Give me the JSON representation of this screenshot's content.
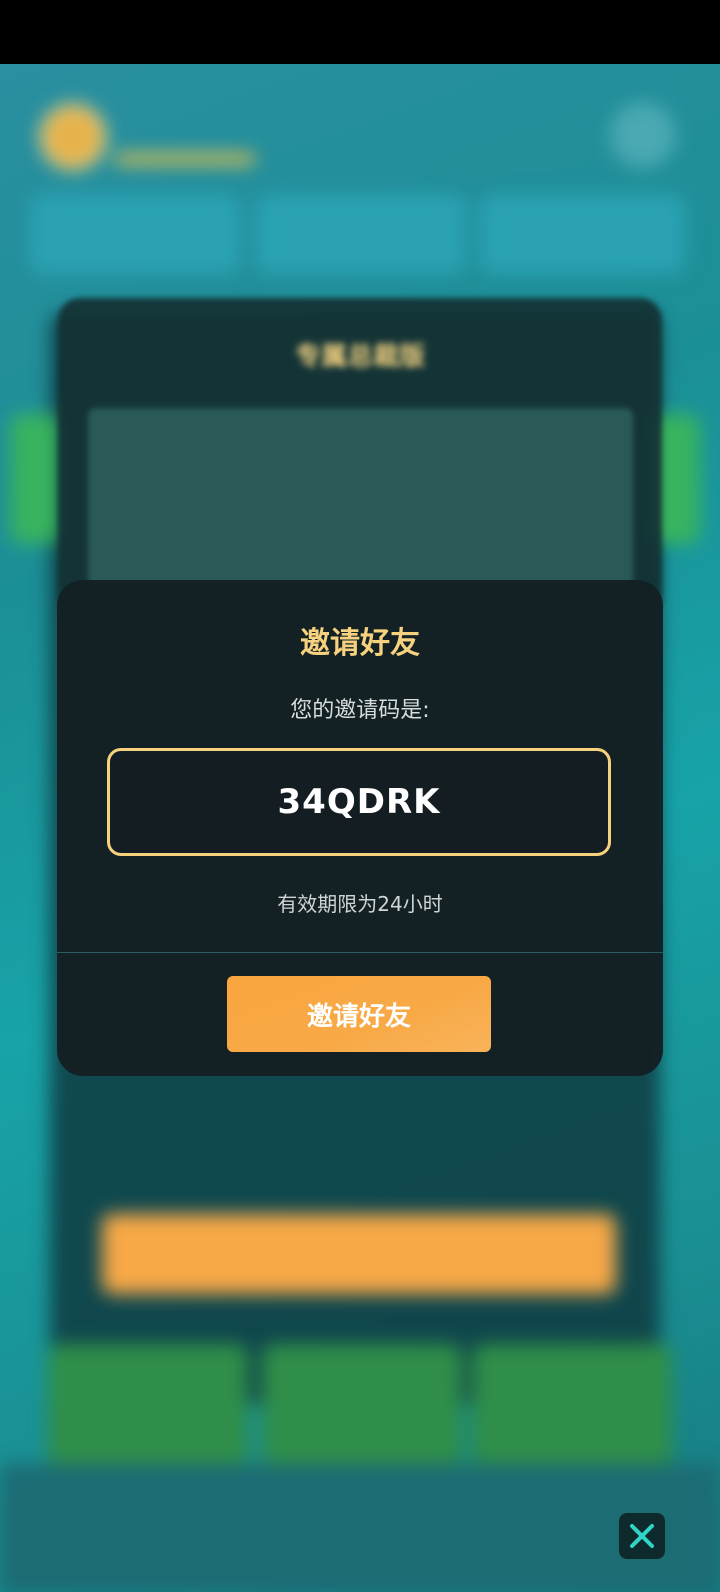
{
  "modal": {
    "title": "邀请好友",
    "subtitle": "您的邀请码是:",
    "invite_code": "34QDRK",
    "validity_note": "有效期限为24小时",
    "button_label": "邀请好友"
  },
  "background_info_card": {
    "title": "专属总裁版"
  },
  "colors": {
    "accent_gold": "#f6d17e",
    "button_orange": "#f9a53f",
    "modal_bg": "#142024",
    "close_icon": "#30d5c8"
  },
  "icons": {
    "close": "close-icon"
  }
}
